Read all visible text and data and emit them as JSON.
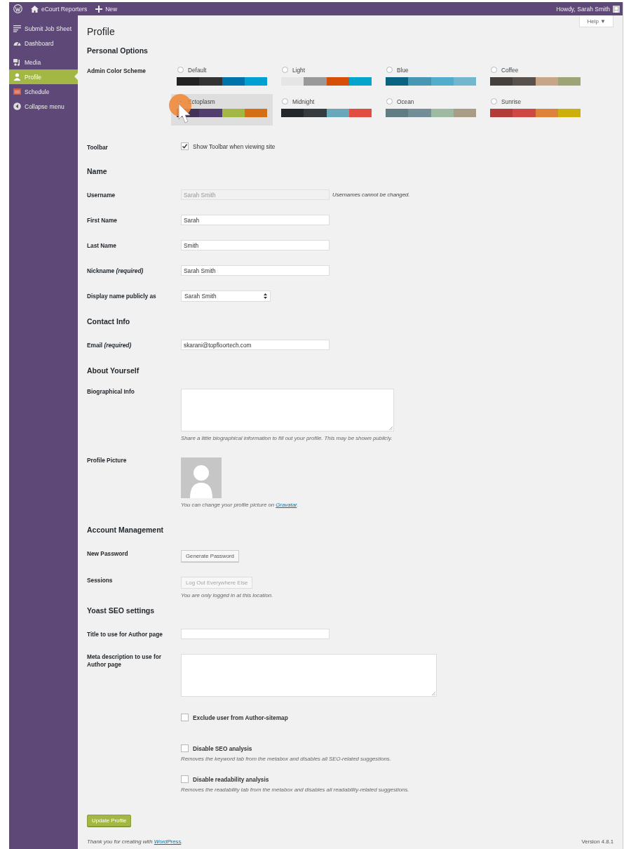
{
  "admin_bar": {
    "site_name": "eCourt Reporters",
    "new_label": "New",
    "greeting": "Howdy, Sarah Smith"
  },
  "sidebar": {
    "items": [
      {
        "label": "Submit Job Sheet",
        "selected": false
      },
      {
        "label": "Dashboard",
        "selected": false
      },
      {
        "label": "Media",
        "selected": false
      },
      {
        "label": "Profile",
        "selected": true
      },
      {
        "label": "Schedule",
        "selected": false
      },
      {
        "label": "Collapse menu",
        "selected": false
      }
    ]
  },
  "help_label": "Help ▼",
  "page_title": "Profile",
  "rows": [
    {
      "kind": "heading",
      "text": "Personal Options"
    },
    {
      "kind": "color_schemes",
      "label": "Admin Color Scheme",
      "schemes": [
        {
          "name": "Default",
          "selected": false,
          "swatches": [
            {
              "color": "#222222"
            },
            {
              "color": "#333333"
            },
            {
              "color": "#0073aa"
            },
            {
              "color": "#00a0d2"
            }
          ]
        },
        {
          "name": "Light",
          "selected": false,
          "swatches": [
            {
              "color": "#e5e5e5"
            },
            {
              "color": "#999999"
            },
            {
              "color": "#d64e07"
            },
            {
              "color": "#04a4cc"
            }
          ]
        },
        {
          "name": "Blue",
          "selected": false,
          "swatches": [
            {
              "color": "#096484"
            },
            {
              "color": "#4796b3"
            },
            {
              "color": "#52accc"
            },
            {
              "color": "#74b6ce"
            }
          ]
        },
        {
          "name": "Coffee",
          "selected": false,
          "swatches": [
            {
              "color": "#46403c"
            },
            {
              "color": "#59524c"
            },
            {
              "color": "#c7a589"
            },
            {
              "color": "#9ea476"
            }
          ]
        },
        {
          "name": "Ectoplasm",
          "selected": true,
          "swatches": [
            {
              "color": "#413256"
            },
            {
              "color": "#523f6d"
            },
            {
              "color": "#a3b745"
            },
            {
              "color": "#d46f15"
            }
          ]
        },
        {
          "name": "Midnight",
          "selected": false,
          "swatches": [
            {
              "color": "#25282b"
            },
            {
              "color": "#363b3f"
            },
            {
              "color": "#69a8bb"
            },
            {
              "color": "#e14d43"
            }
          ]
        },
        {
          "name": "Ocean",
          "selected": false,
          "swatches": [
            {
              "color": "#627c83"
            },
            {
              "color": "#738e96"
            },
            {
              "color": "#9ebaa0"
            },
            {
              "color": "#aa9d88"
            }
          ]
        },
        {
          "name": "Sunrise",
          "selected": false,
          "swatches": [
            {
              "color": "#b43c38"
            },
            {
              "color": "#cf4944"
            },
            {
              "color": "#dd823b"
            },
            {
              "color": "#ccaf0b"
            }
          ]
        }
      ]
    },
    {
      "kind": "checkbox",
      "label": "Toolbar",
      "options": [
        {
          "text": "Show Toolbar when viewing site",
          "checked": true
        }
      ]
    },
    {
      "kind": "heading",
      "text": "Name"
    },
    {
      "kind": "input",
      "label": "Username",
      "value": "Sarah Smith",
      "disabled": true,
      "note": "Usernames cannot be changed."
    },
    {
      "kind": "input",
      "label": "First Name",
      "value": "Sarah",
      "disabled": false
    },
    {
      "kind": "input",
      "label": "Last Name",
      "value": "Smith",
      "disabled": false
    },
    {
      "kind": "input",
      "label": "Nickname *(required)*",
      "value": "Sarah Smith",
      "disabled": false
    },
    {
      "kind": "select",
      "label": "Display name publicly as",
      "value": "Sarah Smith"
    },
    {
      "kind": "heading",
      "text": "Contact Info"
    },
    {
      "kind": "input",
      "label": "Email *(required)*",
      "value": "skarani@topfloortech.com",
      "disabled": false
    },
    {
      "kind": "heading",
      "text": "About Yourself"
    },
    {
      "kind": "textarea",
      "label": "Biographical Info",
      "description": "Share a little biographical information to fill out your profile. This may be shown publicly."
    },
    {
      "kind": "avatar",
      "label": "Profile Picture",
      "description": "You can change your profile picture on ",
      "link": "Gravatar",
      "after": "."
    },
    {
      "kind": "heading",
      "text": "Account Management"
    },
    {
      "kind": "button",
      "label": "New Password",
      "button": "Generate Password",
      "disabled": false
    },
    {
      "kind": "button",
      "label": "Sessions",
      "button": "Log Out Everywhere Else",
      "disabled": true,
      "description": "You are only logged in at this location."
    },
    {
      "kind": "heading",
      "text": "Yoast SEO settings"
    },
    {
      "kind": "input",
      "label": "Title to use for Author page",
      "disabled": false
    },
    {
      "kind": "textarea",
      "label": "Meta description to use for Author page"
    },
    {
      "kind": "checkbox",
      "options": [
        {
          "text": "Exclude user from Author-sitemap",
          "checked": false
        }
      ]
    },
    {
      "kind": "checkbox",
      "options": [
        {
          "text": "Disable SEO analysis",
          "checked": false,
          "description": "Removes the keyword tab from the metabox and disables all SEO-related suggestions."
        }
      ]
    },
    {
      "kind": "checkbox",
      "options": [
        {
          "text": "Disable readability analysis",
          "checked": false,
          "description": "Removes the readability tab from the metabox and disables all readability-related suggestions."
        }
      ]
    }
  ],
  "submit": "Update Profile",
  "footer": {
    "text": "Thank you for creating with ",
    "link": "WordPress",
    "after": ".",
    "version": "Version 4.8.1"
  }
}
